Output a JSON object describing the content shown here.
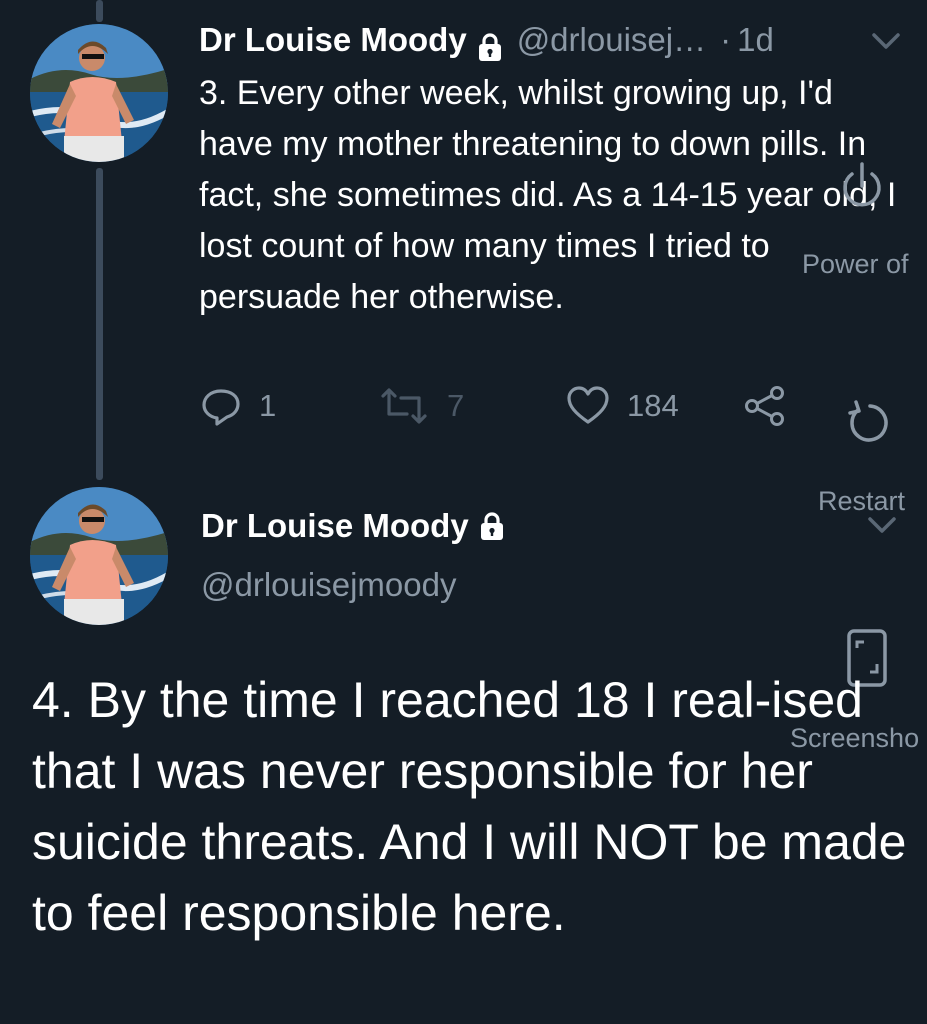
{
  "tweet1": {
    "author_name": "Dr Louise Moody",
    "handle": "@drlouisej…",
    "separator": "·",
    "time": "1d",
    "body": "3. Every other week, whilst growing up, I'd have my mother threatening to down pills. In fact, she sometimes did. As a 14-15 year old, I lost count of how many times I tried to persuade her otherwise.",
    "reply_count": "1",
    "retweet_count": "7",
    "like_count": "184"
  },
  "tweet2": {
    "author_name": "Dr Louise Moody",
    "handle": "@drlouisejmoody",
    "body": "4. By the time I reached 18 I real-ised that I was never responsible for her suicide threats. And I will NOT be made to feel responsible here."
  },
  "overlay": {
    "power_label": "Power of",
    "restart_label": "Restart",
    "screenshot_label": "Screensho"
  },
  "icons": {
    "lock": "lock-icon",
    "reply": "reply-icon",
    "retweet": "retweet-icon",
    "like": "heart-icon",
    "share": "share-icon",
    "chevron": "chevron-down-icon",
    "power": "power-icon",
    "restart": "restart-icon",
    "screenshot": "phone-screenshot-icon"
  },
  "colors": {
    "background": "#141d26",
    "text_primary": "#ffffff",
    "text_secondary": "#8b98a5",
    "thread_line": "#3c4b5c"
  }
}
